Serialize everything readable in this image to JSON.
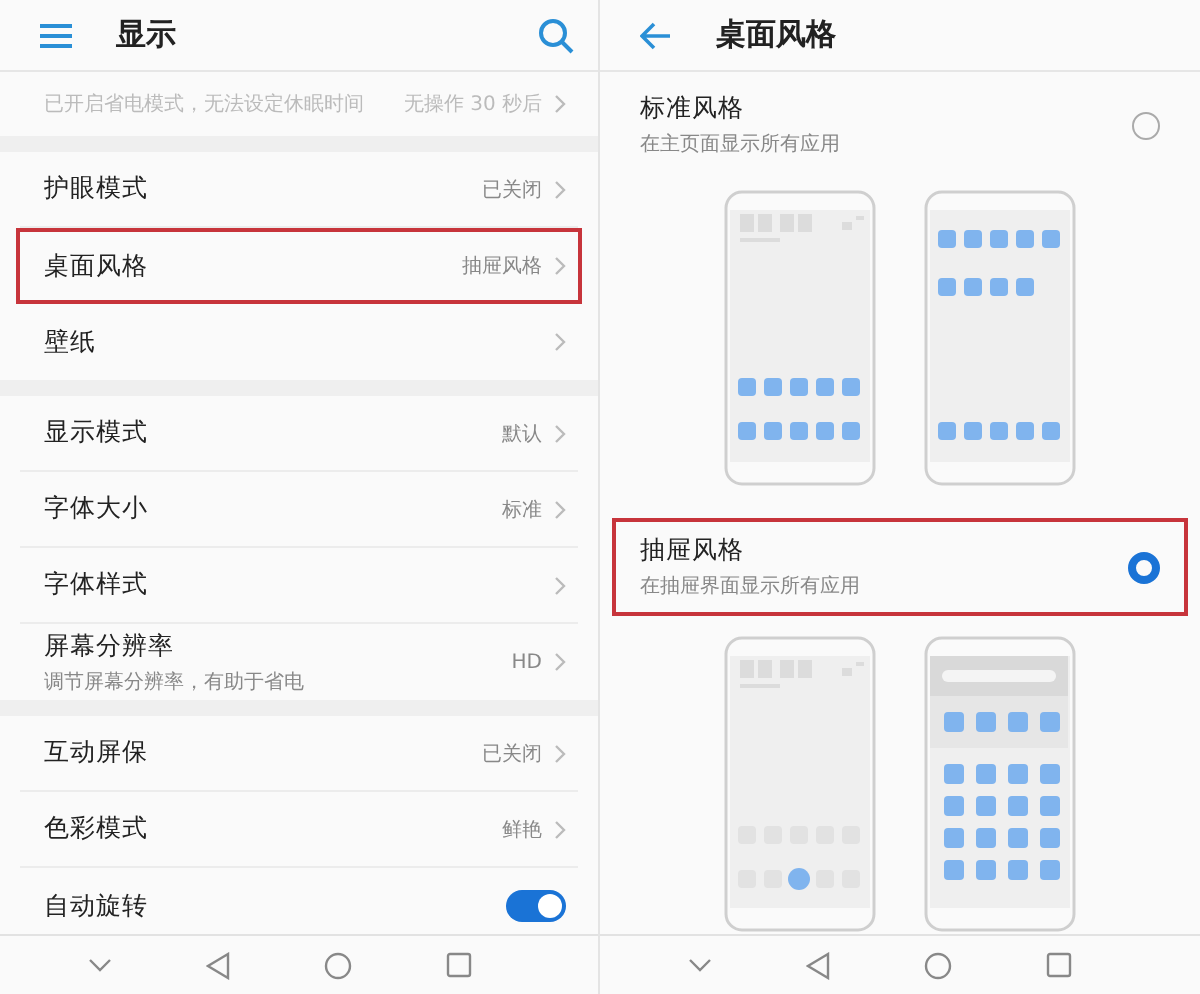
{
  "left": {
    "title": "显示",
    "groups": [
      [
        {
          "kind": "note",
          "label": "已开启省电模式，无法设定休眠时间",
          "value": "无操作 30 秒后",
          "highlighted": false
        }
      ],
      [
        {
          "kind": "link",
          "label": "护眼模式",
          "value": "已关闭",
          "highlighted": false
        },
        {
          "kind": "link",
          "label": "桌面风格",
          "value": "抽屉风格",
          "highlighted": true
        },
        {
          "kind": "link",
          "label": "壁纸",
          "highlighted": false
        }
      ],
      [
        {
          "kind": "link",
          "label": "显示模式",
          "value": "默认",
          "highlighted": false
        },
        {
          "kind": "link",
          "label": "字体大小",
          "value": "标准",
          "highlighted": false
        },
        {
          "kind": "link",
          "label": "字体样式",
          "highlighted": false
        },
        {
          "kind": "link",
          "label": "屏幕分辨率",
          "subtitle": "调节屏幕分辨率，有助于省电",
          "value": "HD",
          "highlighted": false
        }
      ],
      [
        {
          "kind": "link",
          "label": "互动屏保",
          "value": "已关闭",
          "highlighted": false
        },
        {
          "kind": "link",
          "label": "色彩模式",
          "value": "鲜艳",
          "highlighted": false
        },
        {
          "kind": "toggle",
          "label": "自动旋转",
          "on": true,
          "highlighted": false
        }
      ]
    ]
  },
  "right": {
    "title": "桌面风格",
    "options": [
      {
        "kind": "standard",
        "label": "标准风格",
        "subtitle": "在主页面显示所有应用",
        "selected": false,
        "highlighted": false
      },
      {
        "kind": "drawer",
        "label": "抽屉风格",
        "subtitle": "在抽屉界面显示所有应用",
        "selected": true,
        "highlighted": true
      }
    ]
  }
}
